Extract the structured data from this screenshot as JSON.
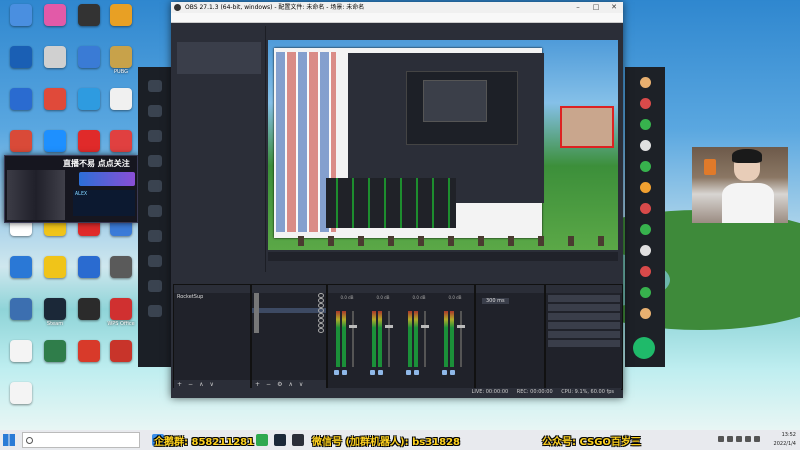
{
  "desktop": {
    "icons": [
      {
        "label": "",
        "color": "#4a8fe0"
      },
      {
        "label": "",
        "color": "#e25aa8"
      },
      {
        "label": "",
        "color": "#333333"
      },
      {
        "label": "",
        "color": "#e8a024"
      },
      {
        "label": "",
        "color": "#1a5fb4"
      },
      {
        "label": "",
        "color": "#d0d0d0"
      },
      {
        "label": "",
        "color": "#3a7bd5"
      },
      {
        "label": "PUBG",
        "color": "#c8a24a"
      },
      {
        "label": "",
        "color": "#2a6bd0"
      },
      {
        "label": "",
        "color": "#e04a3a"
      },
      {
        "label": "",
        "color": "#2e9be0"
      },
      {
        "label": "",
        "color": "#f0f0f0"
      },
      {
        "label": "",
        "color": "#d94a38"
      },
      {
        "label": "",
        "color": "#1e90ff"
      },
      {
        "label": "",
        "color": "#e02a2a"
      },
      {
        "label": "",
        "color": "#e04040"
      },
      {
        "label": "",
        "color": "#2060c0"
      },
      {
        "label": "",
        "color": "#f0c419"
      },
      {
        "label": "",
        "color": "#d84a2a"
      },
      {
        "label": "",
        "color": "#1f8ad8"
      },
      {
        "label": "",
        "color": "#ffffff"
      },
      {
        "label": "",
        "color": "#f0c419"
      },
      {
        "label": "",
        "color": "#e02a2a"
      },
      {
        "label": "",
        "color": "#3b7bd8"
      },
      {
        "label": "",
        "color": "#2a78d6"
      },
      {
        "label": "",
        "color": "#f0c419"
      },
      {
        "label": "",
        "color": "#2a6bd0"
      },
      {
        "label": "",
        "color": "#5a5a5a"
      },
      {
        "label": "",
        "color": "#3c6fb0"
      },
      {
        "label": "Steam",
        "color": "#1b2838"
      },
      {
        "label": "",
        "color": "#2b2b2b"
      },
      {
        "label": "WPS Office",
        "color": "#d03030"
      },
      {
        "label": "",
        "color": "#f4f4f4"
      },
      {
        "label": "",
        "color": "#2f7d4a"
      },
      {
        "label": "",
        "color": "#d83a2a"
      },
      {
        "label": "",
        "color": "#c8342a"
      },
      {
        "label": "",
        "color": "#f4f4f4"
      }
    ]
  },
  "promo_overlay": {
    "title": "直播不易 点点关注",
    "badge": "",
    "lines": [
      "ALEX",
      "",
      ""
    ]
  },
  "obs": {
    "title": "OBS 27.1.3 (64-bit, windows) - 配置文件: 未命名 - 场景: 未命名",
    "menu": [
      "",
      "",
      "",
      "",
      "",
      ""
    ],
    "dock_header": "",
    "card": {
      "title": "",
      "body": ""
    },
    "source_bar": [
      "",
      "",
      ""
    ],
    "scenes": {
      "header": "",
      "items": [
        "",
        "",
        "",
        "RocketSup"
      ]
    },
    "sources": {
      "header": "",
      "items": [
        "",
        "",
        "",
        "",
        "",
        "",
        "",
        ""
      ]
    },
    "mixer": {
      "header": "",
      "channels": [
        {
          "name": "",
          "value": "0.0 dB"
        },
        {
          "name": "",
          "value": "0.0 dB"
        },
        {
          "name": "",
          "value": "0.0 dB"
        },
        {
          "name": "",
          "value": "0.0 dB"
        }
      ]
    },
    "transitions": {
      "header": "",
      "type": "",
      "duration_label": "",
      "duration": "300 ms"
    },
    "controls": {
      "header": "",
      "buttons": [
        "",
        "",
        "",
        "",
        "",
        ""
      ]
    },
    "status": {
      "live": "LIVE: 00:00:00",
      "rec": "REC: 00:00:00",
      "cpu": "CPU: 9.1%, 60.00 fps"
    }
  },
  "preview_caption": "",
  "taskbar": {
    "search_placeholder": "",
    "promos": [
      {
        "text": "企鹅群: 858211281"
      },
      {
        "text": "微信号 (加群机器人): bs31828"
      },
      {
        "text": "公众号: CSGO百岁三"
      }
    ],
    "time": "13:52",
    "date": "2022/1/4"
  }
}
